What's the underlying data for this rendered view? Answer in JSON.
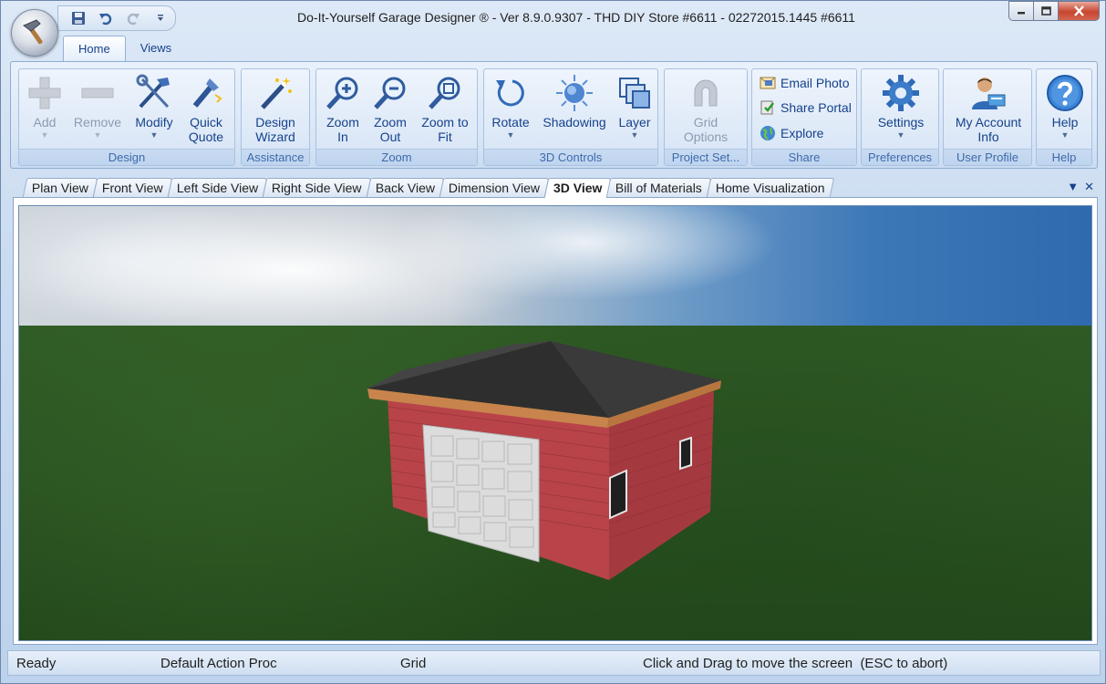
{
  "window": {
    "title": "Do-It-Yourself Garage Designer ® - Ver 8.9.0.9307 - THD DIY Store #6611 - 02272015.1445 #6611"
  },
  "ribbon_tabs": [
    {
      "label": "Home",
      "active": true
    },
    {
      "label": "Views",
      "active": false
    }
  ],
  "ribbon": {
    "design": {
      "label": "Design",
      "add": "Add",
      "remove": "Remove",
      "modify": "Modify",
      "quick_quote_1": "Quick",
      "quick_quote_2": "Quote"
    },
    "assistance": {
      "label": "Assistance",
      "wizard_1": "Design",
      "wizard_2": "Wizard"
    },
    "zoom": {
      "label": "Zoom",
      "zoom_in_1": "Zoom",
      "zoom_in_2": "In",
      "zoom_out_1": "Zoom",
      "zoom_out_2": "Out",
      "zoom_fit_1": "Zoom to",
      "zoom_fit_2": "Fit"
    },
    "controls3d": {
      "label": "3D Controls",
      "rotate": "Rotate",
      "shadowing": "Shadowing",
      "layer": "Layer"
    },
    "project": {
      "label": "Project Set...",
      "grid_1": "Grid",
      "grid_2": "Options"
    },
    "share": {
      "label": "Share",
      "email_photo": "Email Photo",
      "share_portal": "Share Portal",
      "explore": "Explore"
    },
    "preferences": {
      "label": "Preferences",
      "settings": "Settings"
    },
    "user_profile": {
      "label": "User Profile",
      "account_1": "My Account",
      "account_2": "Info"
    },
    "help": {
      "label": "Help",
      "help": "Help"
    }
  },
  "doc_tabs": [
    {
      "label": "Plan View",
      "active": false
    },
    {
      "label": "Front View",
      "active": false
    },
    {
      "label": "Left Side View",
      "active": false
    },
    {
      "label": "Right Side View",
      "active": false
    },
    {
      "label": "Back View",
      "active": false
    },
    {
      "label": "Dimension View",
      "active": false
    },
    {
      "label": "3D View",
      "active": true
    },
    {
      "label": "Bill of Materials",
      "active": false
    },
    {
      "label": "Home Visualization",
      "active": false
    }
  ],
  "status": {
    "ready": "Ready",
    "action": "Default Action Proc",
    "grid": "Grid",
    "hint": "Click and Drag to move the screen  (ESC to abort)"
  },
  "colors": {
    "siding": "#b8444a",
    "roof": "#2e2e2e",
    "trim": "#c8844c",
    "door": "#dcdcdc",
    "grass": "#2a5221",
    "sky": "#3c77b7"
  },
  "icons": {
    "app_orb": "hammer-icon",
    "save": "save-icon",
    "undo": "undo-icon",
    "redo": "redo-icon"
  }
}
